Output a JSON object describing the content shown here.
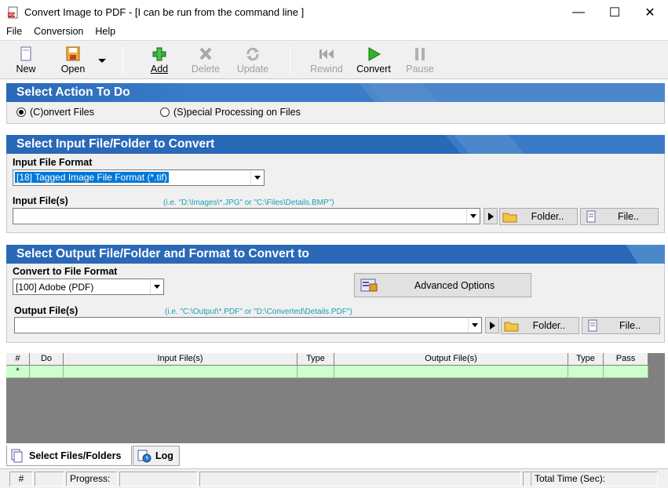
{
  "window": {
    "title": "Convert Image to PDF - [I can be run from the command line ]",
    "minimize": "—",
    "maximize": "☐",
    "close": "✕"
  },
  "menu": [
    "File",
    "Conversion",
    "Help"
  ],
  "toolbar": {
    "new": "New",
    "open": "Open",
    "add": "Add",
    "delete": "Delete",
    "update": "Update",
    "rewind": "Rewind",
    "convert": "Convert",
    "pause": "Pause"
  },
  "action_section": {
    "title": "Select Action To Do",
    "option_convert": "(C)onvert Files",
    "option_special": "(S)pecial Processing on Files",
    "selected": "convert"
  },
  "input_section": {
    "title": "Select Input File/Folder to Convert",
    "format_label": "Input File Format",
    "format_value": "[18] Tagged Image File Format (*.tif)",
    "files_label": "Input File(s)",
    "files_hint": "(i.e. \"D:\\Images\\*.JPG\" or \"C:\\Files\\Details.BMP\")",
    "files_value": "",
    "folder_button": "Folder..",
    "file_button": "File.."
  },
  "output_section": {
    "title": "Select Output File/Folder and Format to Convert to",
    "format_label": "Convert to File Format",
    "format_value": "[100] Adobe (PDF)",
    "advanced_button": "Advanced Options",
    "files_label": "Output File(s)",
    "files_hint": "(i.e. \"C:\\Output\\*.PDF\" or \"D:\\Converted\\Details.PDF\")",
    "files_value": "",
    "folder_button": "Folder..",
    "file_button": "File.."
  },
  "grid": {
    "columns": [
      "#",
      "Do",
      "Input File(s)",
      "Type",
      "Output File(s)",
      "Type",
      "Pass"
    ],
    "new_row_marker": "*"
  },
  "tabs": [
    "Select Files/Folders",
    "Log"
  ],
  "statusbar": {
    "number": "#",
    "progress_label": "Progress:",
    "total_time": "Total Time (Sec):"
  },
  "colors": {
    "header_blue": "#1e60b4",
    "grid_row_green": "#ccffcc",
    "hint_teal": "#1aa0b0"
  }
}
